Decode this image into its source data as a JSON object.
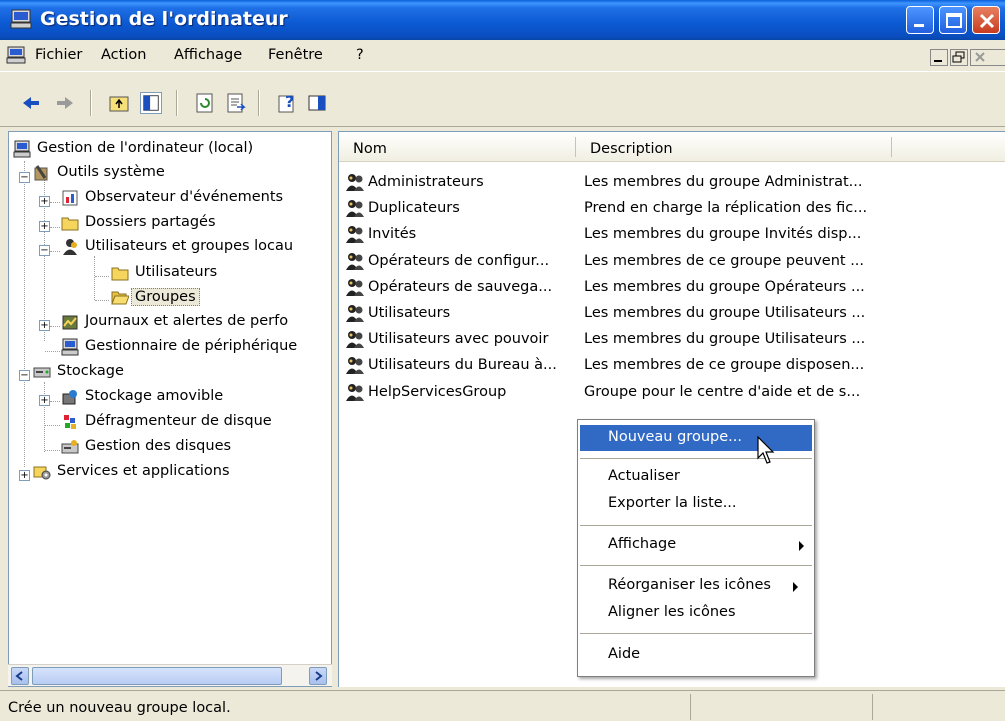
{
  "window": {
    "title": "Gestion de l'ordinateur"
  },
  "menu": [
    "Fichier",
    "Action",
    "Affichage",
    "Fenêtre",
    "?"
  ],
  "toolbar": {
    "icons": [
      "back-icon",
      "forward-icon",
      "up-folder-icon",
      "show-hide-tree-icon",
      "refresh-icon",
      "export-list-icon",
      "help-icon",
      "show-hide-action-pane-icon"
    ]
  },
  "tree": {
    "root": "Gestion de l'ordinateur (local)",
    "outils": "Outils système",
    "observateur": "Observateur d'événements",
    "dossiers": "Dossiers partagés",
    "utilisateurs_groupes": "Utilisateurs et groupes locau",
    "utilisateurs": "Utilisateurs",
    "groupes": "Groupes",
    "journaux": "Journaux et alertes de perfo",
    "gestionnaire": "Gestionnaire de périphérique",
    "stockage": "Stockage",
    "amovible": "Stockage amovible",
    "defrag": "Défragmenteur de disque",
    "disques": "Gestion des disques",
    "services": "Services et applications"
  },
  "list": {
    "col_name": "Nom",
    "col_desc": "Description",
    "rows": [
      {
        "name": "Administrateurs",
        "desc": "Les membres du groupe Administrat..."
      },
      {
        "name": "Duplicateurs",
        "desc": "Prend en charge la réplication des fic..."
      },
      {
        "name": "Invités",
        "desc": "Les membres du groupe Invités disp..."
      },
      {
        "name": "Opérateurs de configur...",
        "desc": "Les membres de ce groupe peuvent ..."
      },
      {
        "name": "Opérateurs de sauvega...",
        "desc": "Les membres du groupe Opérateurs ..."
      },
      {
        "name": "Utilisateurs",
        "desc": "Les membres du groupe Utilisateurs ..."
      },
      {
        "name": "Utilisateurs avec pouvoir",
        "desc": "Les membres du groupe Utilisateurs ..."
      },
      {
        "name": "Utilisateurs du Bureau à...",
        "desc": "Les membres de ce groupe disposen..."
      },
      {
        "name": "HelpServicesGroup",
        "desc": "Groupe pour le centre d'aide et de s..."
      }
    ]
  },
  "context_menu": {
    "nouveau": "Nouveau groupe...",
    "actualiser": "Actualiser",
    "exporter": "Exporter la liste...",
    "affichage": "Affichage",
    "reorganiser": "Réorganiser les icônes",
    "aligner": "Aligner les icônes",
    "aide": "Aide"
  },
  "status": {
    "text": "Crée un nouveau groupe local."
  },
  "colors": {
    "title_bar": "#0b59d2",
    "highlight": "#316ac5",
    "chrome": "#ece9d8"
  }
}
